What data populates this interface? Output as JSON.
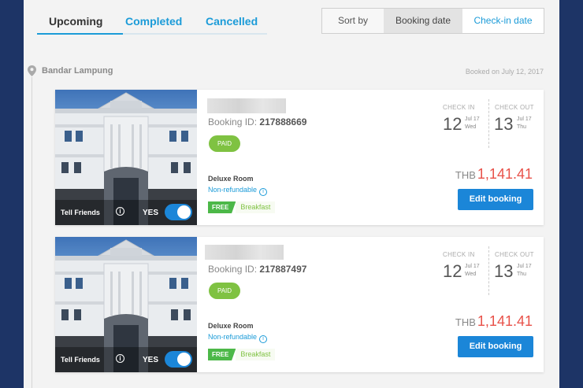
{
  "tabs": [
    {
      "label": "Upcoming"
    },
    {
      "label": "Completed"
    },
    {
      "label": "Cancelled"
    }
  ],
  "sort": {
    "label": "Sort by",
    "options": [
      {
        "label": "Booking date",
        "selected": true
      },
      {
        "label": "Check-in date",
        "selected": false
      }
    ]
  },
  "group": {
    "city": "Bandar Lampung",
    "booked_on": "Booked on July 12, 2017"
  },
  "bookings": [
    {
      "booking_id_label": "Booking ID:",
      "booking_id": "217888669",
      "status": "PAID",
      "room_type": "Deluxe Room",
      "refund_policy": "Non-refundable",
      "perk_tag": "FREE",
      "perk": "Breakfast",
      "check_in_label": "CHECK IN",
      "check_in_day": "12",
      "check_in_month": "Jul 17",
      "check_in_weekday": "Wed",
      "check_out_label": "CHECK OUT",
      "check_out_day": "13",
      "check_out_month": "Jul 17",
      "check_out_weekday": "Thu",
      "currency": "THB",
      "price": "1,141.41",
      "edit_label": "Edit booking",
      "tell_friends": "Tell Friends",
      "share_toggle_label": "YES"
    },
    {
      "booking_id_label": "Booking ID:",
      "booking_id": "217887497",
      "status": "PAID",
      "room_type": "Deluxe Room",
      "refund_policy": "Non-refundable",
      "perk_tag": "FREE",
      "perk": "Breakfast",
      "check_in_label": "CHECK IN",
      "check_in_day": "12",
      "check_in_month": "Jul 17",
      "check_in_weekday": "Wed",
      "check_out_label": "CHECK OUT",
      "check_out_day": "13",
      "check_out_month": "Jul 17",
      "check_out_weekday": "Thu",
      "currency": "THB",
      "price": "1,141.41",
      "edit_label": "Edit booking",
      "tell_friends": "Tell Friends",
      "share_toggle_label": "YES"
    }
  ],
  "colors": {
    "accent": "#1b9bd8",
    "button": "#1b86d8",
    "price": "#e8524a",
    "paid": "#7fc242",
    "outer_background": "#1d3466"
  }
}
